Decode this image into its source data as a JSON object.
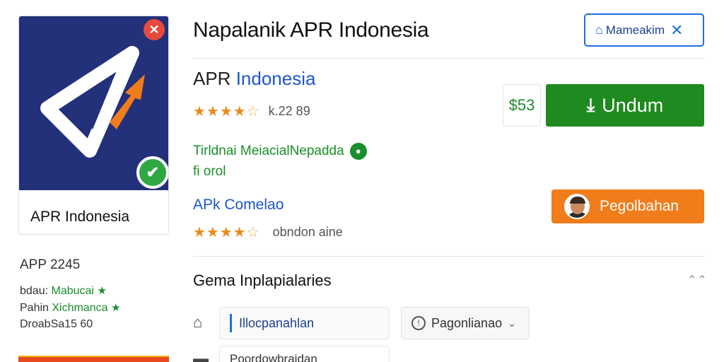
{
  "header": {
    "title": "Napalanik APR Indonesia",
    "manage_button": "Mameakim"
  },
  "app_card": {
    "name": "APR Indonesia",
    "icon_bg": "#23307a",
    "accent": "#f07c1a"
  },
  "sidebar": {
    "version": "APP 2245",
    "rows": [
      {
        "label": "bdau:",
        "value": "Mabucai"
      },
      {
        "label": "Pahin",
        "value": "Xichmanca"
      },
      {
        "label": "DroabSa15 60",
        "value": ""
      }
    ]
  },
  "app": {
    "name_part1": "APR",
    "name_part2": "Indonesia",
    "rating": 4.5,
    "rating_count": "k.22 89",
    "developer": "Tirldnai MeiacialNepadda",
    "developer_sub": "fi orol",
    "price": "$53",
    "download_label": "Undum",
    "review_title": "APk Comelao",
    "review_rating": 4.5,
    "review_note": "obndon aine",
    "update_label": "Pegolbahan"
  },
  "section": {
    "title": "Gema Inplapialaries",
    "field1": "Illocpanahlan",
    "dropdown": "Pagonlianao",
    "field2": "Poordowbraidan"
  },
  "colors": {
    "primary_blue": "#1d6fe0",
    "green": "#1f8a1f",
    "orange": "#f07c1a",
    "star": "#e98a1d"
  }
}
